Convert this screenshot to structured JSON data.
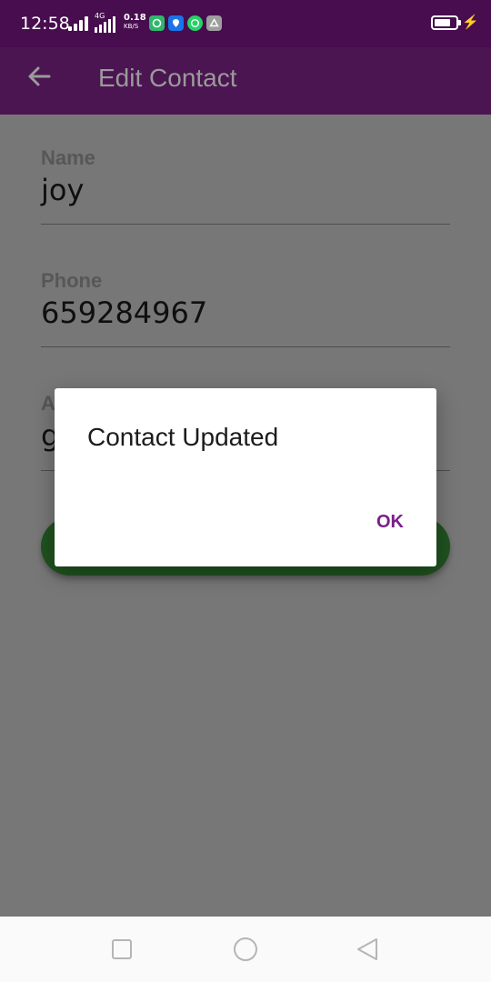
{
  "status_bar": {
    "time": "12:58",
    "network_type": "4G",
    "speed_value": "0.18",
    "speed_unit": "KB/S",
    "battery_level": 0.75,
    "icons": [
      "signal-icon",
      "4g-signal-icon",
      "app-notification-icon",
      "location-icon",
      "whatsapp-icon",
      "drive-icon",
      "battery-icon",
      "charging-icon"
    ]
  },
  "app_bar": {
    "title": "Edit Contact",
    "back_icon": "arrow-left-icon"
  },
  "form": {
    "name_label": "Name",
    "name_value": "joy",
    "phone_label": "Phone",
    "phone_value": "659284967",
    "third_label_visible": "A",
    "third_value_visible": "g"
  },
  "dialog": {
    "message": "Contact Updated",
    "ok_label": "OK"
  },
  "colors": {
    "status_bar": "#470d4f",
    "app_bar": "#4b1552",
    "scrim_content": "#777777",
    "save_button": "#20521f",
    "dialog_ok": "#7a1f88"
  },
  "nav_bar": {
    "icons": [
      "recent-apps-icon",
      "home-icon",
      "back-icon"
    ]
  }
}
